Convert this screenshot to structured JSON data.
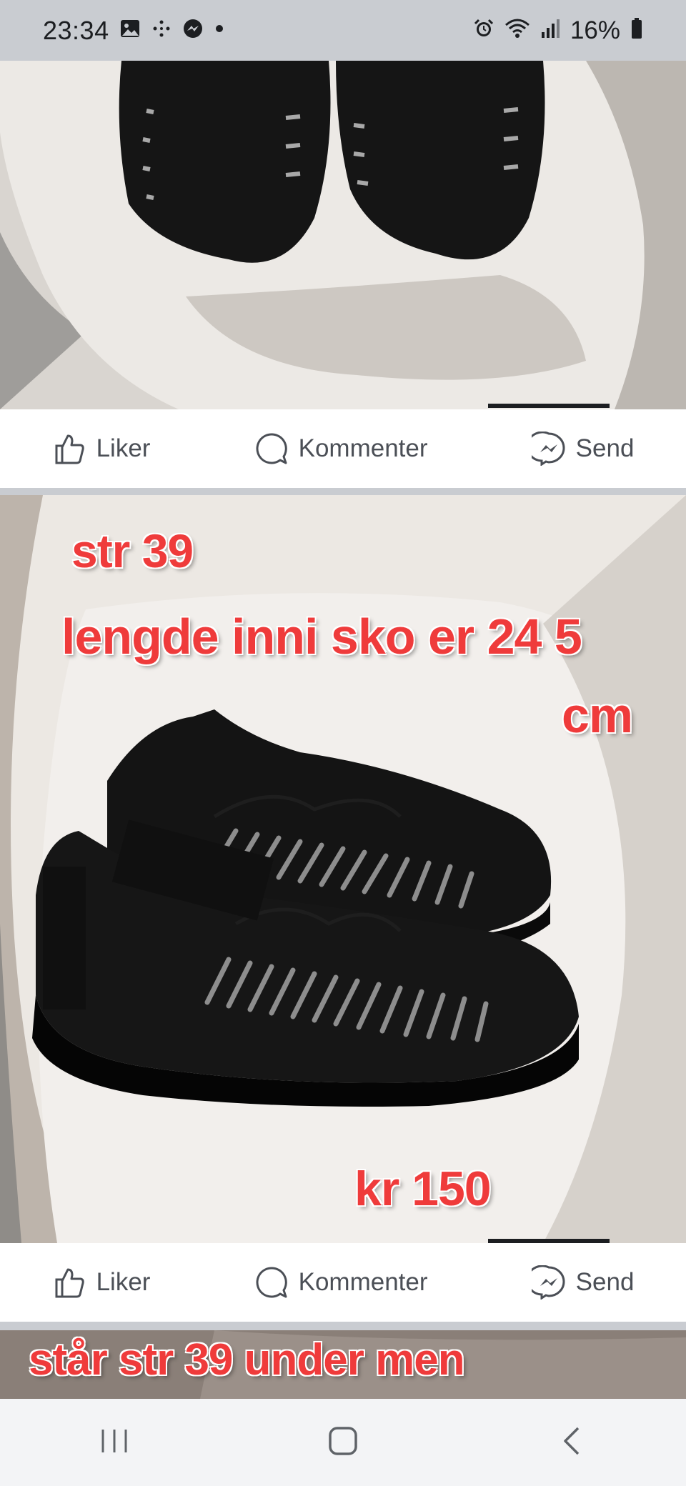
{
  "status_bar": {
    "time": "23:34",
    "battery": "16%",
    "left_icons": [
      "gallery-icon",
      "sparkle-icon",
      "messenger-icon",
      "dot-icon"
    ],
    "right_icons": [
      "alarm-icon",
      "wifi-icon",
      "signal-icon",
      "battery-icon"
    ]
  },
  "posts": [
    {
      "actions": {
        "like_label": "Liker",
        "comment_label": "Kommenter",
        "send_label": "Send"
      }
    },
    {
      "overlay": {
        "line1": "str 39",
        "line2": "lengde inni sko er 24 5",
        "line3": "cm",
        "price": "kr 150"
      },
      "actions": {
        "like_label": "Liker",
        "comment_label": "Kommenter",
        "send_label": "Send"
      }
    },
    {
      "overlay": {
        "line1": "står str 39 under men"
      }
    }
  ],
  "colors": {
    "overlay_text": "#ef3b3b",
    "action_text": "#4b4f56",
    "status_bg": "#c9ccd1"
  },
  "navigation": [
    "recents-icon",
    "home-icon",
    "back-icon"
  ]
}
